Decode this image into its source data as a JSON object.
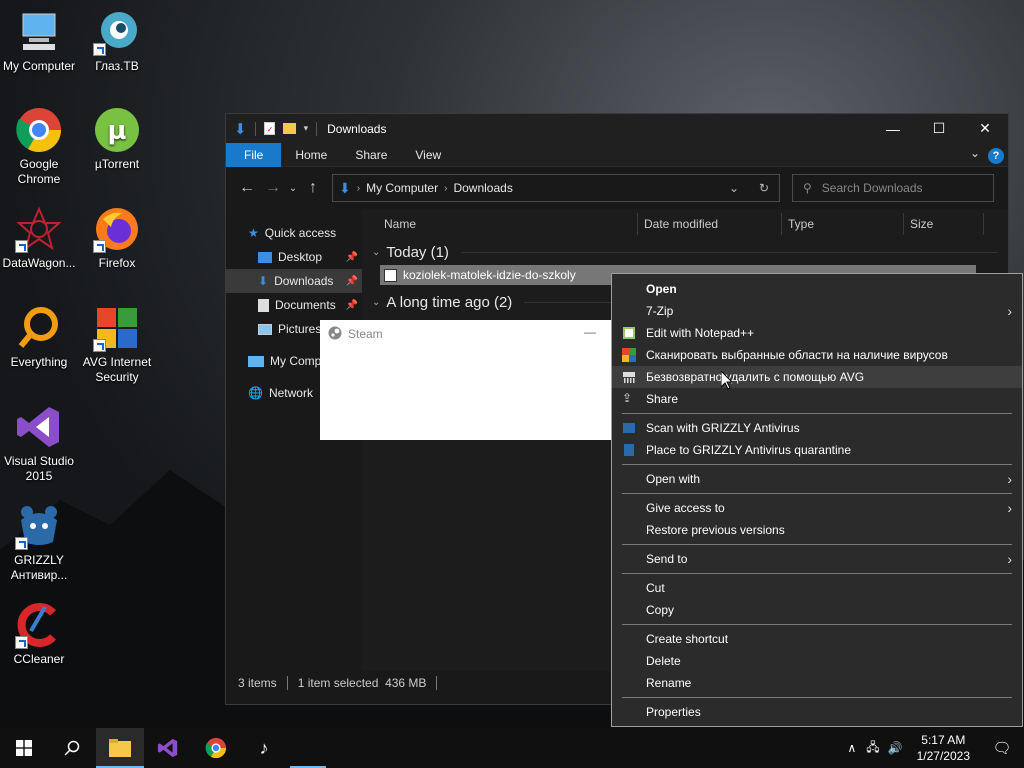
{
  "desktop": {
    "icons": [
      {
        "label": "My Computer"
      },
      {
        "label": "Глаз.ТВ"
      },
      {
        "label": "Google Chrome"
      },
      {
        "label": "µTorrent"
      },
      {
        "label": "DataWagon..."
      },
      {
        "label": "Firefox"
      },
      {
        "label": "Everything"
      },
      {
        "label": "AVG Internet Security"
      },
      {
        "label": "Visual Studio 2015"
      },
      {
        "label": "GRIZZLY Антивир..."
      },
      {
        "label": "CCleaner"
      }
    ]
  },
  "explorer": {
    "title": "Downloads",
    "ribbon_tabs": [
      "File",
      "Home",
      "Share",
      "View"
    ],
    "address": [
      "My Computer",
      "Downloads"
    ],
    "search_placeholder": "Search Downloads",
    "nav": {
      "quick_access": "Quick access",
      "desktop": "Desktop",
      "downloads": "Downloads",
      "documents": "Documents",
      "pictures": "Pictures",
      "my_computer": "My Comp",
      "network": "Network"
    },
    "columns": [
      "Name",
      "Date modified",
      "Type",
      "Size"
    ],
    "groups": [
      {
        "label": "Today (1)",
        "files": [
          "koziolek-matolek-idzie-do-szkoly"
        ]
      },
      {
        "label": "A long time ago (2)"
      }
    ],
    "status": {
      "items": "3 items",
      "selected": "1 item selected  436 MB"
    }
  },
  "steam": {
    "title": "Steam",
    "minimize": "—"
  },
  "context_menu": {
    "items": [
      {
        "label": "Open",
        "bold": true
      },
      {
        "label": "7-Zip",
        "submenu": true
      },
      {
        "label": "Edit with Notepad++",
        "icon": "notepad-icon"
      },
      {
        "label": "Сканировать выбранные области на наличие вирусов",
        "icon": "avg-icon"
      },
      {
        "label": "Безвозвратно удалить с помощью AVG",
        "icon": "shredder-icon",
        "highlighted": true
      },
      {
        "label": "Share",
        "icon": "share-icon"
      },
      {
        "label": "Scan with GRIZZLY Antivirus",
        "icon": "grizzly-icon"
      },
      {
        "label": "Place to GRIZZLY Antivirus quarantine",
        "icon": "grizzly-icon"
      },
      {
        "label": "Open with",
        "submenu": true
      },
      {
        "label": "Give access to",
        "submenu": true
      },
      {
        "label": "Restore previous versions"
      },
      {
        "label": "Send to",
        "submenu": true
      },
      {
        "label": "Cut"
      },
      {
        "label": "Copy"
      },
      {
        "label": "Create shortcut"
      },
      {
        "label": "Delete"
      },
      {
        "label": "Rename"
      },
      {
        "label": "Properties"
      }
    ]
  },
  "taskbar": {
    "time": "5:17 AM",
    "date": "1/27/2023"
  },
  "colors": {
    "accent": "#1979ca",
    "menu_bg": "#2b2b2b",
    "explorer_bg": "#191919"
  }
}
